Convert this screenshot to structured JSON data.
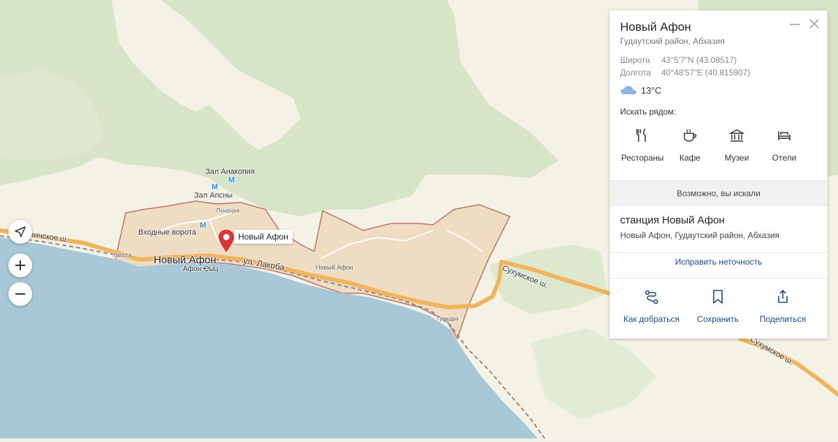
{
  "map": {
    "labels": {
      "zal_anakopiya": "Зал Анакопия",
      "zal_apsny": "Зал Апсны",
      "vkhodnye_vorota": "Входные ворота",
      "psyrtskha": "Псырцха",
      "lapsta": "Лапста",
      "novy_afon_big": "Новый Афон",
      "afon_ytsh": "Афон Ҿыц",
      "ul_lakoba": "ул. Лакоба",
      "novy_afon_station": "Новый Афон",
      "sukhumskoe_1": "Сухумское ш.",
      "sukhumskoe_2": "Сухумское ш.",
      "sochinskoe": "Сочинское ш.",
      "guandra": "Гуандра",
      "metro_symbol": "M"
    },
    "pin": {
      "label": "Новый Афон",
      "color": "#d9343a"
    },
    "colors": {
      "sea": "#a8c8d8",
      "land": "#f4f2e4",
      "forest": "#d7e4c8",
      "city_area": "#ecd4b8",
      "boundary": "#c0706a",
      "road": "#f0b55c",
      "metro": "#2f8fd0"
    },
    "controls": {
      "location_icon": "navigation-arrow-icon",
      "zoom_in_icon": "plus-icon",
      "zoom_out_icon": "minus-icon"
    }
  },
  "card": {
    "title": "Новый Афон",
    "subtitle": "Гудаутский район, Абхазия",
    "lat_label": "Широта",
    "lat_value": "43°5′7″N (43.08517)",
    "lon_label": "Долгота",
    "lon_value": "40°48′57″E (40.815907)",
    "weather": {
      "icon": "cloud-icon",
      "temp": "13°C"
    },
    "search_nearby_label": "Искать рядом:",
    "categories": [
      {
        "icon": "fork-knife-icon",
        "label": "Рестораны"
      },
      {
        "icon": "coffee-cup-icon",
        "label": "Кафе"
      },
      {
        "icon": "museum-icon",
        "label": "Музеи"
      },
      {
        "icon": "bed-icon",
        "label": "Отели"
      }
    ],
    "maybe_searched": "Возможно, вы искали",
    "result": {
      "title": "станция Новый Афон",
      "subtitle": "Новый Афон, Гудаутский район, Абхазия"
    },
    "fix_link": "Исправить неточность",
    "actions": [
      {
        "icon": "route-icon",
        "label": "Как добраться"
      },
      {
        "icon": "bookmark-icon",
        "label": "Сохранить"
      },
      {
        "icon": "share-icon",
        "label": "Поделиться"
      }
    ],
    "accent": "#1a4a8a"
  }
}
